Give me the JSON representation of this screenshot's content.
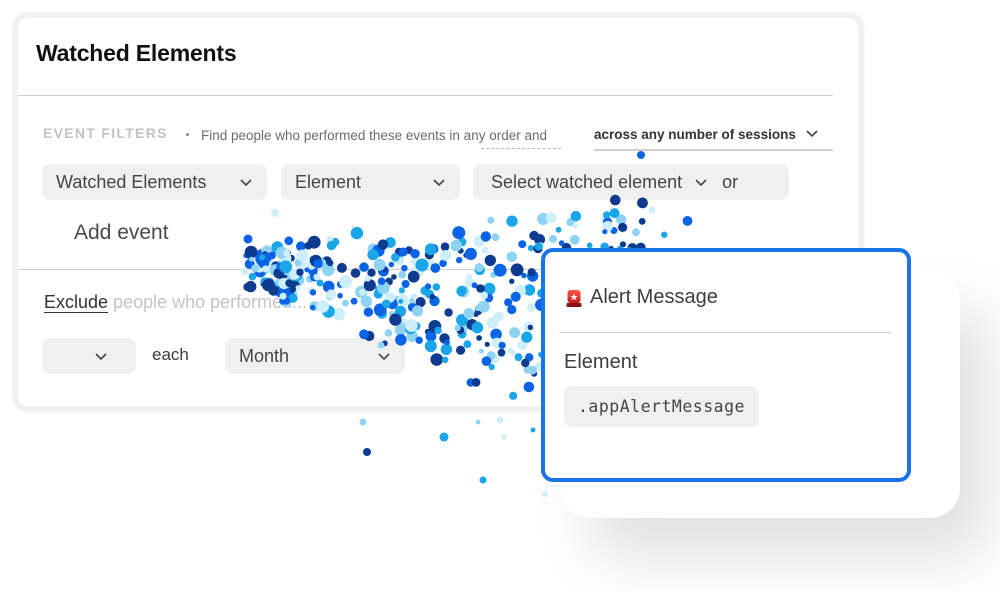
{
  "card": {
    "title": "Watched Elements",
    "filters": {
      "label": "EVENT FILTERS",
      "description_prefix": "Find people who performed these events",
      "order_term": "in any order",
      "and_word": "and",
      "sessions_select": "across any number of sessions"
    },
    "event_row": {
      "event_select": "Watched Elements",
      "property_select": "Element",
      "value_select": "Select watched element",
      "or_label": "or"
    },
    "add_event_label": "Add event",
    "exclude": {
      "link": "Exclude",
      "rest": "people who performed..."
    },
    "frequency_row": {
      "count_select": "",
      "each_label": "each",
      "period_select": "Month"
    }
  },
  "popup": {
    "icon": "siren-icon",
    "title": "Alert Message",
    "field_label": "Element",
    "selector_value": ".appAlertMessage",
    "accent_color": "#1a73e8"
  },
  "decor": {
    "dot_colors": [
      "#0b63e5",
      "#0f3b8f",
      "#1aa6e8",
      "#8fd3f4",
      "#cdeefb"
    ]
  }
}
